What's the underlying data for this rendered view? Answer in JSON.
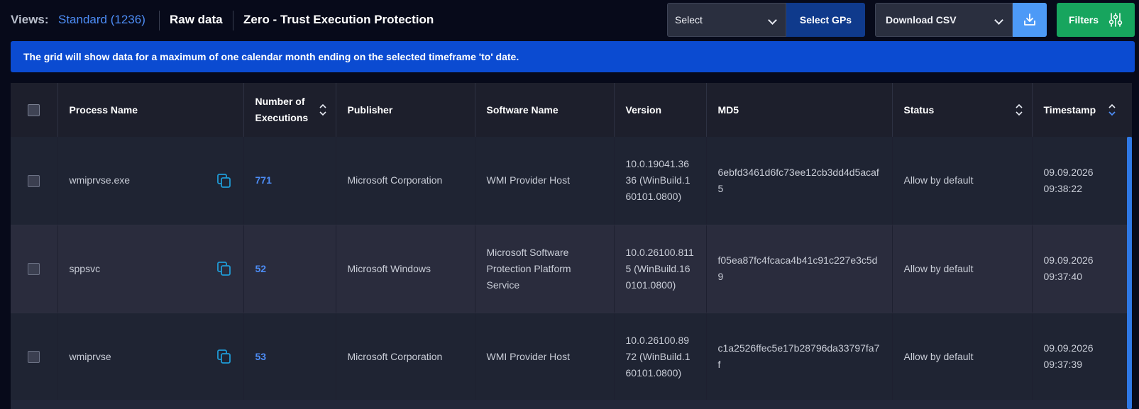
{
  "views": {
    "label": "Views:",
    "standard": "Standard (1236)",
    "raw": "Raw data",
    "zero": "Zero - Trust Execution Protection"
  },
  "toolbar": {
    "select_label": "Select",
    "select_gps_label": "Select GPs",
    "download_csv_label": "Download CSV",
    "filters_label": "Filters"
  },
  "banner": {
    "text": "The grid will show data for a maximum of one calendar month ending on the selected timeframe 'to' date."
  },
  "table": {
    "columns": {
      "process": "Process Name",
      "executions": "Number of Executions",
      "publisher": "Publisher",
      "software": "Software Name",
      "version": "Version",
      "md5": "MD5",
      "status": "Status",
      "timestamp": "Timestamp"
    },
    "rows": [
      {
        "process": "wmiprvse.exe",
        "executions": "771",
        "publisher": "Microsoft Corporation",
        "software": "WMI Provider Host",
        "version": "10.0.19041.3636 (WinBuild.160101.0800)",
        "md5": "6ebfd3461d6fc73ee12cb3dd4d5acaf5",
        "status": "Allow by default",
        "timestamp": "09.09.2026 09:38:22"
      },
      {
        "process": "sppsvc",
        "executions": "52",
        "publisher": "Microsoft Windows",
        "software": "Microsoft Software Protection Platform Service",
        "version": "10.0.26100.8115 (WinBuild.160101.0800)",
        "md5": "f05ea87fc4fcaca4b41c91c227e3c5d9",
        "status": "Allow by default",
        "timestamp": "09.09.2026 09:37:40"
      },
      {
        "process": "wmiprvse",
        "executions": "53",
        "publisher": "Microsoft Corporation",
        "software": "WMI Provider Host",
        "version": "10.0.26100.8972 (WinBuild.160101.0800)",
        "md5": "c1a2526ffec5e17b28796da33797fa7f",
        "status": "Allow by default",
        "timestamp": "09.09.2026 09:37:39"
      }
    ]
  },
  "colors": {
    "background": "#070a1a",
    "link": "#4d8df6",
    "banner": "#0b4bd1",
    "filters": "#17a55e",
    "select_gps": "#0f3a8c",
    "download": "#4d9af7"
  },
  "icons": {
    "copy": "copy-icon",
    "download": "download-icon",
    "filters": "sliders-icon",
    "sort": "sort-icon",
    "chevron": "chevron-down-icon"
  }
}
